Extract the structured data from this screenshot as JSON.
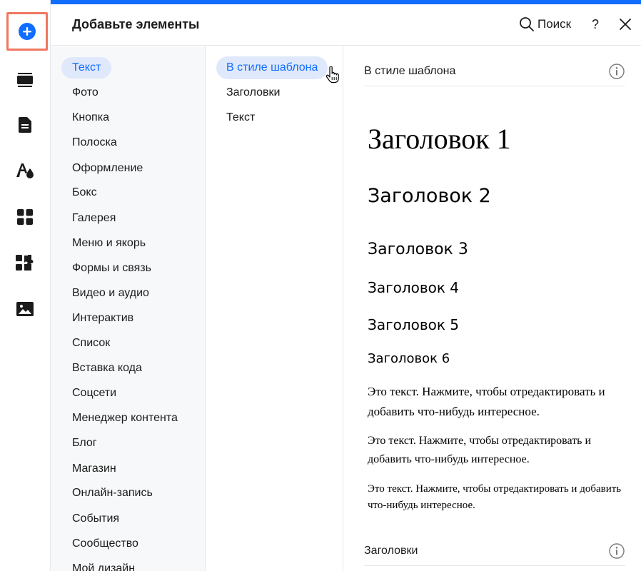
{
  "rail": {
    "items": [
      {
        "icon": "add-icon",
        "active": true
      },
      {
        "icon": "sections-icon"
      },
      {
        "icon": "pages-icon"
      },
      {
        "icon": "design-icon"
      },
      {
        "icon": "apps-icon"
      },
      {
        "icon": "puzzle-icon"
      },
      {
        "icon": "media-icon"
      }
    ],
    "accent_color": "#116dff",
    "highlight_color": "#f0775f"
  },
  "header": {
    "title": "Добавьте элементы",
    "search_label": "Поиск",
    "help_label": "?"
  },
  "categories": [
    {
      "label": "Текст",
      "selected": true
    },
    {
      "label": "Фото"
    },
    {
      "label": "Кнопка"
    },
    {
      "label": "Полоска"
    },
    {
      "label": "Оформление"
    },
    {
      "label": "Бокс"
    },
    {
      "label": "Галерея"
    },
    {
      "label": "Меню и якорь"
    },
    {
      "label": "Формы и связь"
    },
    {
      "label": "Видео и аудио"
    },
    {
      "label": "Интерактив"
    },
    {
      "label": "Список"
    },
    {
      "label": "Вставка кода"
    },
    {
      "label": "Соцсети"
    },
    {
      "label": "Менеджер контента"
    },
    {
      "label": "Блог"
    },
    {
      "label": "Магазин"
    },
    {
      "label": "Онлайн-запись"
    },
    {
      "label": "События"
    },
    {
      "label": "Сообщество"
    },
    {
      "label": "Мой дизайн"
    }
  ],
  "subcategories": [
    {
      "label": "В стиле шаблона",
      "selected": true
    },
    {
      "label": "Заголовки"
    },
    {
      "label": "Текст"
    }
  ],
  "preview": {
    "section_title": "В стиле шаблона",
    "headings": [
      "Заголовок 1",
      "Заголовок 2",
      "Заголовок 3",
      "Заголовок 4",
      "Заголовок 5",
      "Заголовок 6"
    ],
    "paragraphs": [
      "Это текст. Нажмите, чтобы отредактировать и добавить что-нибудь интересное.",
      "Это текст. Нажмите, чтобы отредактировать и добавить что-нибудь интересное.",
      "Это текст. Нажмите, чтобы отредактировать и добавить что-нибудь интересное."
    ],
    "next_section_title": "Заголовки"
  }
}
